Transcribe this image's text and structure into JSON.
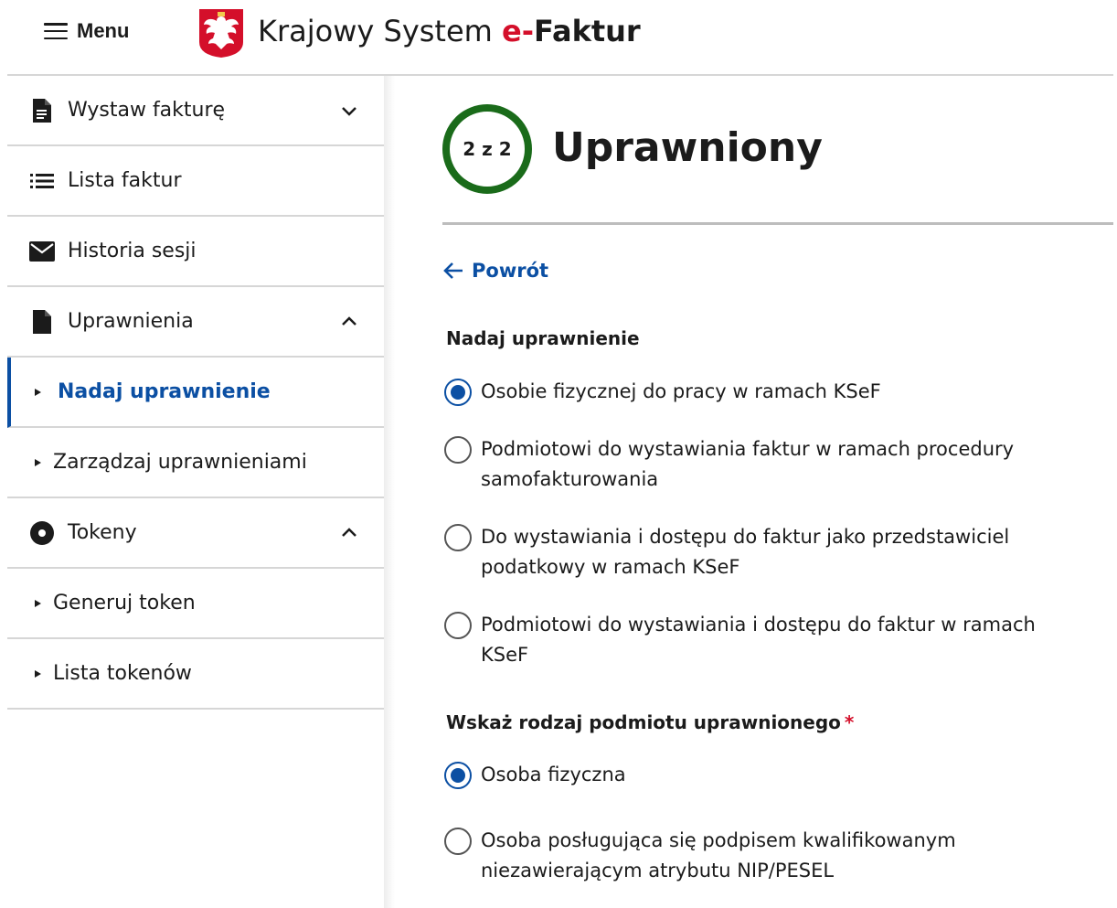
{
  "header": {
    "menu_label": "Menu",
    "brand_prefix": "Krajowy System ",
    "brand_accent": "e-",
    "brand_bold": "Faktur"
  },
  "sidebar": {
    "items": [
      {
        "label": "Wystaw fakturę",
        "icon": "document-icon",
        "chevron": "down"
      },
      {
        "label": "Lista faktur",
        "icon": "list-icon"
      },
      {
        "label": "Historia sesji",
        "icon": "mail-icon"
      },
      {
        "label": "Uprawnienia",
        "icon": "file-icon",
        "chevron": "up"
      },
      {
        "label": "Nadaj uprawnienie",
        "sub": true,
        "active": true
      },
      {
        "label": "Zarządzaj uprawnieniami",
        "sub": true
      },
      {
        "label": "Tokeny",
        "icon": "token-icon",
        "chevron": "up"
      },
      {
        "label": "Generuj token",
        "sub": true
      },
      {
        "label": "Lista tokenów",
        "sub": true
      }
    ]
  },
  "main": {
    "step": "2 z 2",
    "title": "Uprawniony",
    "back_label": "Powrót",
    "section1": {
      "title": "Nadaj uprawnienie",
      "options": [
        {
          "label": "Osobie fizycznej do pracy w ramach KSeF",
          "checked": true
        },
        {
          "label": "Podmiotowi do wystawiania faktur w ramach procedury samofakturowania",
          "checked": false
        },
        {
          "label": "Do wystawiania i dostępu do faktur jako przedstawiciel podatkowy w ramach KSeF",
          "checked": false
        },
        {
          "label": "Podmiotowi do wystawiania i dostępu do faktur w ramach KSeF",
          "checked": false
        }
      ]
    },
    "section2": {
      "title": "Wskaż rodzaj podmiotu uprawnionego",
      "required_mark": "*",
      "options": [
        {
          "label": "Osoba fizyczna",
          "checked": true
        },
        {
          "label": "Osoba posługująca się podpisem kwalifikowanym niezawierającym atrybutu NIP/PESEL",
          "checked": false
        }
      ]
    }
  },
  "colors": {
    "accent_blue": "#0b4fa3",
    "brand_red": "#d40f2a",
    "step_green": "#1a6b1a"
  }
}
